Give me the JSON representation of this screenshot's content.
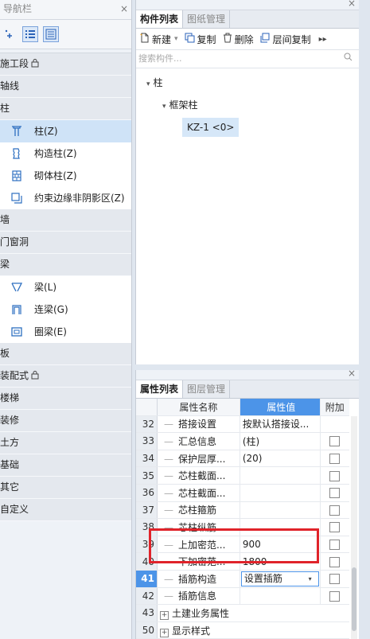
{
  "nav": {
    "title": "导航栏",
    "close": "×",
    "categories_top": [
      {
        "label": "施工段",
        "has_icon": true
      },
      {
        "label": "轴线"
      },
      {
        "label": "柱"
      }
    ],
    "column_items": [
      {
        "label": "柱(Z)",
        "icon": "column-icon",
        "selected": true
      },
      {
        "label": "构造柱(Z)",
        "icon": "structural-column-icon"
      },
      {
        "label": "砌体柱(Z)",
        "icon": "masonry-column-icon"
      },
      {
        "label": "约束边缘非阴影区(Z)",
        "icon": "constraint-edge-icon"
      }
    ],
    "categories_mid": [
      "墙",
      "门窗洞",
      "梁"
    ],
    "beam_items": [
      {
        "label": "梁(L)",
        "icon": "beam-icon"
      },
      {
        "label": "连梁(G)",
        "icon": "coupling-beam-icon"
      },
      {
        "label": "圈梁(E)",
        "icon": "ring-beam-icon"
      }
    ],
    "categories_bottom": [
      {
        "label": "板"
      },
      {
        "label": "装配式",
        "has_icon": true
      },
      {
        "label": "楼梯"
      },
      {
        "label": "装修"
      },
      {
        "label": "土方"
      },
      {
        "label": "基础"
      },
      {
        "label": "其它"
      },
      {
        "label": "自定义"
      }
    ]
  },
  "component_list": {
    "close": "×",
    "tabs": [
      "构件列表",
      "图纸管理"
    ],
    "toolbar": {
      "new": "新建",
      "copy": "复制",
      "delete": "删除",
      "floor_copy": "层间复制"
    },
    "search_placeholder": "搜索构件...",
    "tree": {
      "root": "柱",
      "child": "框架柱",
      "leaf": "KZ-1 <0>"
    }
  },
  "property_list": {
    "close": "×",
    "tabs": [
      "属性列表",
      "图层管理"
    ],
    "headers": {
      "name": "属性名称",
      "value": "属性值",
      "add": "附加"
    },
    "rows": [
      {
        "num": "32",
        "name": "搭接设置",
        "value": "按默认搭接设...",
        "check": false
      },
      {
        "num": "33",
        "name": "汇总信息",
        "value": "(柱)",
        "check": true
      },
      {
        "num": "34",
        "name": "保护层厚...",
        "value": "(20)",
        "check": true
      },
      {
        "num": "35",
        "name": "芯柱截面...",
        "value": "",
        "check": true
      },
      {
        "num": "36",
        "name": "芯柱截面...",
        "value": "",
        "check": true
      },
      {
        "num": "37",
        "name": "芯柱箍筋",
        "value": "",
        "check": true
      },
      {
        "num": "38",
        "name": "芯柱纵筋",
        "value": "",
        "check": true
      },
      {
        "num": "39",
        "name": "上加密范...",
        "value": "900",
        "check": true
      },
      {
        "num": "40",
        "name": "下加密范...",
        "value": "1800",
        "check": true
      },
      {
        "num": "41",
        "name": "插筋构造",
        "value": "设置插筋",
        "check": true,
        "selected": true
      },
      {
        "num": "42",
        "name": "插筋信息",
        "value": "",
        "check": true
      }
    ],
    "groups": [
      {
        "num": "43",
        "name": "土建业务属性"
      },
      {
        "num": "50",
        "name": "显示样式"
      }
    ]
  }
}
